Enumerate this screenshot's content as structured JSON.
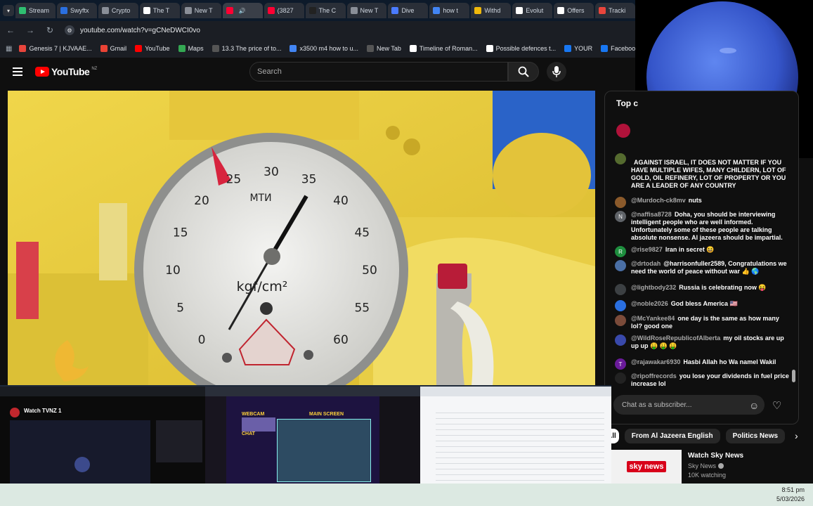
{
  "browser": {
    "tabs": [
      {
        "label": "Stream",
        "color": "#2fbf71"
      },
      {
        "label": "Swyftx",
        "color": "#2a6fe0"
      },
      {
        "label": "Crypto",
        "color": "#8a8f98"
      },
      {
        "label": "The T",
        "color": "#ffffff"
      },
      {
        "label": "New T",
        "color": "#8a8f98"
      },
      {
        "label": "",
        "color": "#ff0033",
        "active": true
      },
      {
        "label": "(3827",
        "color": "#ff0033"
      },
      {
        "label": "The C",
        "color": "#222222"
      },
      {
        "label": "New T",
        "color": "#8a8f98"
      },
      {
        "label": "Dive",
        "color": "#4a7bff"
      },
      {
        "label": "how t",
        "color": "#4285f4"
      },
      {
        "label": "Withd",
        "color": "#f0b90b"
      },
      {
        "label": "Evolut",
        "color": "#ffffff"
      },
      {
        "label": "Offers",
        "color": "#ffffff"
      },
      {
        "label": "Tracki",
        "color": "#e8453c"
      }
    ],
    "url": "youtube.com/watch?v=gCNeDWCI0vo",
    "bookmarks": [
      {
        "label": "Genesis 7 | KJVAAE...",
        "color": "#e8453c"
      },
      {
        "label": "Gmail",
        "color": "#ea4335"
      },
      {
        "label": "YouTube",
        "color": "#ff0000"
      },
      {
        "label": "Maps",
        "color": "#34a853"
      },
      {
        "label": "13.3 The price of to...",
        "color": "#555555"
      },
      {
        "label": "x3500 m4 how to u...",
        "color": "#4285f4"
      },
      {
        "label": "New Tab",
        "color": "#555555"
      },
      {
        "label": "Timeline of Roman...",
        "color": "#ffffff"
      },
      {
        "label": "Possible defences t...",
        "color": "#ffffff"
      },
      {
        "label": "YOUR",
        "color": "#1877f2"
      },
      {
        "label": "Facebook green",
        "color": "#1877f2"
      }
    ]
  },
  "youtube": {
    "logo_text": "YouTube",
    "region": "NZ",
    "search_placeholder": "Search"
  },
  "chat": {
    "title": "Top c",
    "messages": [
      {
        "author": "",
        "text": "AGAINST ISRAEL, IT DOES NOT MATTER IF YOU HAVE MULTIPLE WIFES, MANY CHILDERN, LOT OF GOLD, OIL REFINERY, LOT OF PROPERTY OR YOU ARE A LEADER OF ANY COUNTRY",
        "avatar": "",
        "color": "#556b2f"
      },
      {
        "author": "@Murdoch-ck8mv",
        "text": "nuts",
        "avatar": "",
        "color": "#8b5a2b"
      },
      {
        "author": "@naffisa8728",
        "text": "Doha, you should be interviewing intelligent people who are well informed. Unfortunately some of these people are talking absolute nonsense. Al jazeera should be impartial.",
        "avatar": "N",
        "color": "#5f6368"
      },
      {
        "author": "@rise9827",
        "text": "Iran in secret 😆",
        "avatar": "R",
        "color": "#1e8e3e"
      },
      {
        "author": "@drtodah",
        "text": "@harrisonfuller2589, Congratulations we need the world of peace without war 👍 🌎",
        "avatar": "",
        "color": "#4a6fa5"
      },
      {
        "author": "@lightbody232",
        "text": "Russia is celebrating now 😝",
        "avatar": "",
        "color": "#3c4043"
      },
      {
        "author": "@noble2026",
        "text": "God bless America 🇺🇸",
        "avatar": "",
        "color": "#2a6fe0"
      },
      {
        "author": "@McYankee84",
        "text": "one day is the same as how many lol? good one",
        "avatar": "",
        "color": "#7b4b3a"
      },
      {
        "author": "@WildRoseRepublicofAlberta",
        "text": "my oil stocks are up up up 🤑 🤑 🤑",
        "avatar": "",
        "color": "#3949ab"
      },
      {
        "author": "@rajawakar6930",
        "text": "Hasbi Allah ho Wa namel Wakil",
        "avatar": "T",
        "color": "#6a1b9a"
      },
      {
        "author": "@ripoffrecords",
        "text": "you lose your dividends in fuel price increase lol",
        "avatar": "",
        "color": "#222222"
      }
    ],
    "input_placeholder": "Chat as a subscriber..."
  },
  "chips": [
    "All",
    "From Al Jazeera English",
    "Politics News"
  ],
  "recommendation": {
    "title": "Watch Sky News",
    "channel": "Sky News",
    "stat": "10K watching",
    "logo_text": "sky news"
  },
  "thumbnails": {
    "left_title": "Watch TVNZ 1",
    "middle_labels": [
      "WEBCAM",
      "MAIN SCREEN",
      "CHAT"
    ]
  },
  "gauge": {
    "unit": "kgf/cm²",
    "brand": "МТИ",
    "ticks": [
      "0",
      "5",
      "10",
      "15",
      "20",
      "25",
      "30",
      "35",
      "40",
      "45",
      "50",
      "55",
      "60"
    ]
  },
  "taskbar": {
    "time": "8:51 pm",
    "date": "5/03/2026"
  }
}
